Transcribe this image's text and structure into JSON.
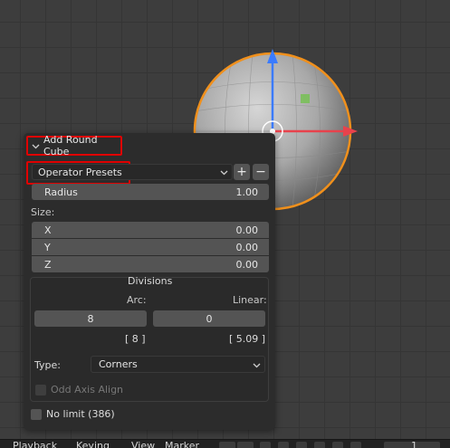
{
  "panel": {
    "title": "Add Round Cube",
    "presets_label": "Operator Presets",
    "add_preset": "+",
    "remove_preset": "−",
    "radius": {
      "label": "Radius",
      "value": "1.00"
    },
    "size_label": "Size:",
    "size": [
      {
        "label": "X",
        "value": "0.00"
      },
      {
        "label": "Y",
        "value": "0.00"
      },
      {
        "label": "Z",
        "value": "0.00"
      }
    ],
    "divisions": {
      "title": "Divisions",
      "arc_label": "Arc:",
      "linear_label": "Linear:",
      "arc_value": "8",
      "linear_value": "0",
      "arc_computed": "[ 8 ]",
      "linear_computed": "[ 5.09 ]",
      "type_label": "Type:",
      "type_value": "Corners",
      "odd_axis_label": "Odd Axis Align"
    },
    "no_limit_label": "No limit (386)"
  },
  "timeline": {
    "items": [
      "Playback",
      "Keying",
      "View",
      "Marker"
    ],
    "frame": "1"
  },
  "colors": {
    "selection_outline": "#f0901c",
    "axis_x": "#e8424c",
    "axis_z": "#3a7bff",
    "highlight_box": "#e00000",
    "panel_bg": "#2c2c2c",
    "field_bg": "#545454"
  },
  "icons": {
    "collapse": "chevron-down-icon",
    "dropdown": "chevron-down-icon",
    "transport": [
      "jump-start-icon",
      "prev-keyframe-icon",
      "play-reverse-icon",
      "play-icon",
      "next-keyframe-icon",
      "jump-end-icon"
    ]
  }
}
